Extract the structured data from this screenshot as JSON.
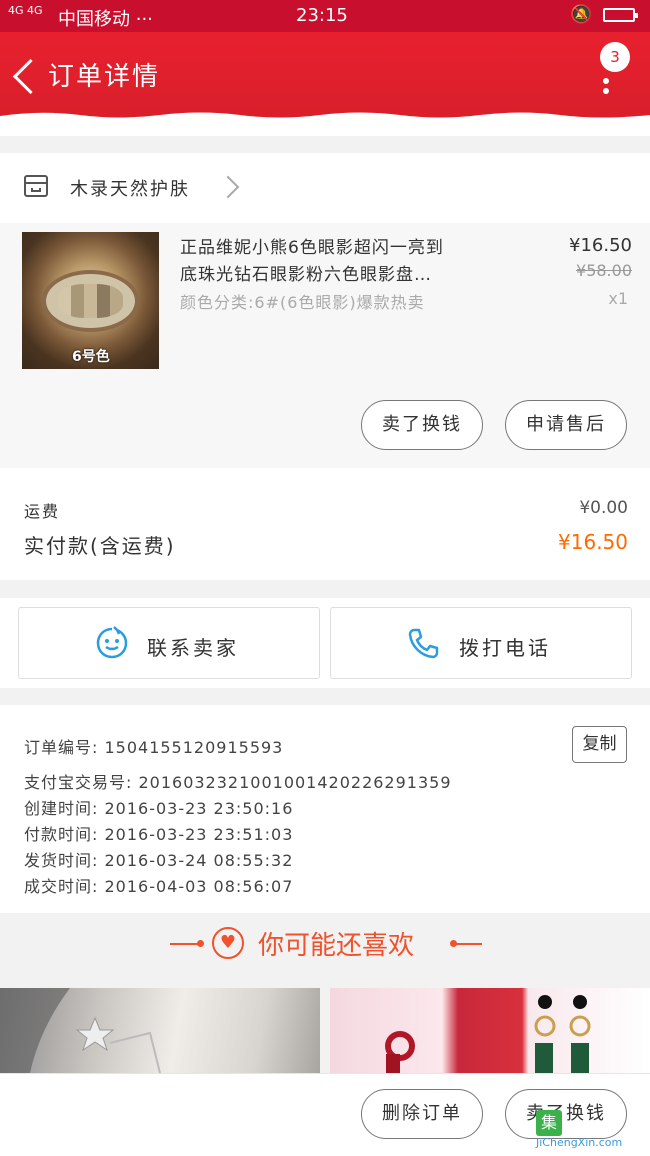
{
  "status_bar": {
    "signal": "4G 4G",
    "carrier": "中国移动 ···",
    "time": "23:15"
  },
  "header": {
    "title": "订单详情",
    "badge_count": "3"
  },
  "store": {
    "name": "木录天然护肤"
  },
  "product": {
    "image_tag": "6号色",
    "title_line1": "正品维妮小熊6色眼影超闪一亮到",
    "title_line2": "底珠光钻石眼影粉六色眼影盘…",
    "spec": "颜色分类:6#(6色眼影)爆款热卖",
    "price": "¥16.50",
    "original_price": "¥58.00",
    "quantity": "x1"
  },
  "product_actions": {
    "sell": "卖了换钱",
    "after_sale": "申请售后"
  },
  "totals": {
    "shipping_label": "运费",
    "shipping_value": "¥0.00",
    "paid_label": "实付款(含运费)",
    "paid_value": "¥16.50"
  },
  "contact": {
    "seller": "联系卖家",
    "phone": "拨打电话"
  },
  "order_info": {
    "copy": "复制",
    "rows": [
      "订单编号: 1504155120915593",
      "支付宝交易号: 2016032321001001420226291359",
      "创建时间: 2016-03-23 23:50:16",
      "付款时间: 2016-03-23 23:51:03",
      "发货时间: 2016-03-24 08:55:32",
      "成交时间: 2016-04-03 08:56:07"
    ]
  },
  "recommend": {
    "title": "你可能还喜欢"
  },
  "bottom_bar": {
    "delete": "删除订单",
    "sell": "卖了换钱"
  },
  "watermark": {
    "logo": "集",
    "text": "JiChengXin.com"
  },
  "colors": {
    "brand_red": "#e8202e",
    "price_orange": "#ff6a00",
    "accent_orange": "#f0522b",
    "icon_blue": "#2a9de0"
  }
}
